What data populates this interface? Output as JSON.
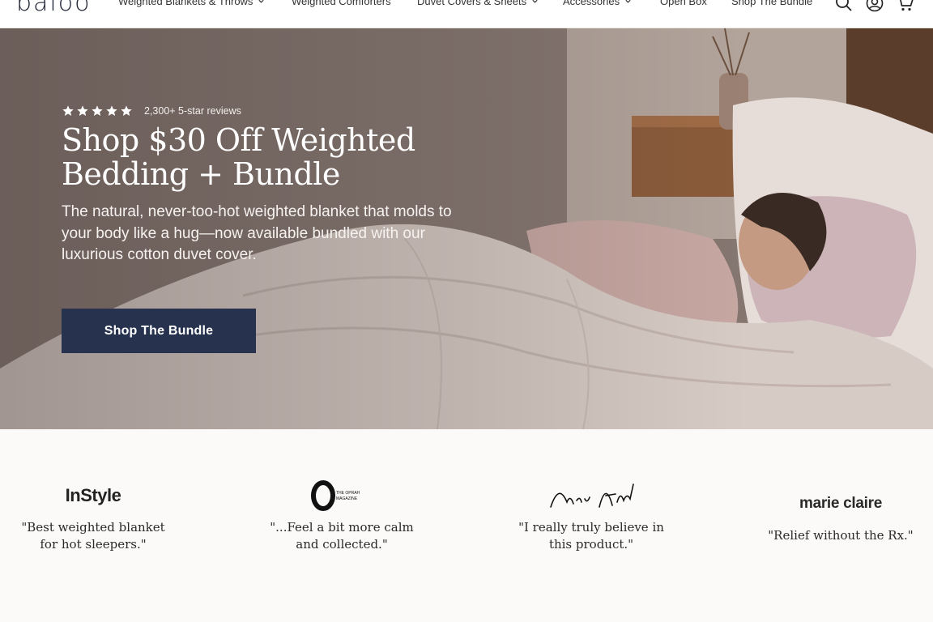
{
  "header": {
    "logo": "baloo",
    "nav": [
      {
        "label": "Weighted Blankets & Throws",
        "has_dropdown": true
      },
      {
        "label": "Weighted Comforters",
        "has_dropdown": false
      },
      {
        "label": "Duvet Covers & Sheets",
        "has_dropdown": true
      },
      {
        "label": "Accessories",
        "has_dropdown": true
      },
      {
        "label": "Open Box",
        "has_dropdown": false
      },
      {
        "label": "Shop The Bundle",
        "has_dropdown": false
      }
    ],
    "icons": [
      "search-icon",
      "account-icon",
      "cart-icon"
    ]
  },
  "hero": {
    "rating_stars": 5,
    "review_text": "2,300+ 5-star reviews",
    "headline_line1": "Shop $30 Off Weighted",
    "headline_line2": "Bedding + Bundle",
    "subcopy": "The natural, never-too-hot weighted blanket that molds to your body like a hug—now available bundled with our luxurious cotton duvet cover.",
    "cta_label": "Shop The Bundle"
  },
  "press": [
    {
      "logo": "InStyle",
      "quote_line1": "\"Best weighted blanket",
      "quote_line2": "for hot sleepers.\""
    },
    {
      "logo": "O THE OPRAH MAGAZINE",
      "quote_line1": "\"...Feel a bit more calm",
      "quote_line2": "and collected.\""
    },
    {
      "logo": "Dave Asprey",
      "quote_line1": "\"I really truly believe in",
      "quote_line2": "this product.\""
    },
    {
      "logo": "marie claire",
      "quote_line1": "\"Relief without the Rx.\"",
      "quote_line2": ""
    }
  ],
  "colors": {
    "cta_background": "#27324f",
    "header_background": "#ffffff",
    "page_background": "#fbfaf8"
  }
}
